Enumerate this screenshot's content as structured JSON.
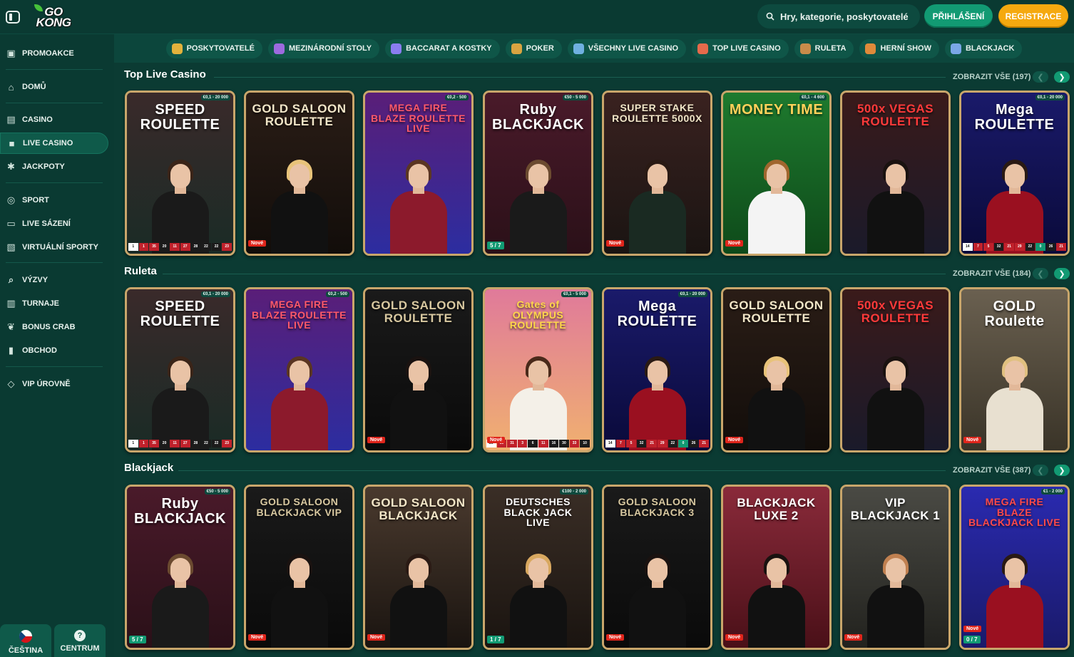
{
  "colors": {
    "bg": "#0b3b33",
    "accent_green": "#129a73",
    "accent_orange": "#f5a90f",
    "card_border": "#c9a66b",
    "badge_red": "#e0251b"
  },
  "header": {
    "logo_line1": "GO",
    "logo_line2": "KONG",
    "search_placeholder": "Hry, kategorie, poskytovatelé",
    "login_label": "Přihlášení",
    "register_label": "Registrace"
  },
  "sidebar": {
    "items": [
      {
        "label": "Promoakce",
        "icon": "gift-icon"
      },
      {
        "label": "Domů",
        "icon": "home-icon"
      },
      {
        "label": "Casino",
        "icon": "slot-machine-icon"
      },
      {
        "label": "Live Casino",
        "icon": "live-casino-icon",
        "active": true
      },
      {
        "label": "Jackpoty",
        "icon": "jackpot-icon"
      },
      {
        "label": "Sport",
        "icon": "soccer-ball-icon"
      },
      {
        "label": "Live sázení",
        "icon": "live-betting-icon"
      },
      {
        "label": "Virtuální sporty",
        "icon": "virtual-sports-icon"
      },
      {
        "label": "Výzvy",
        "icon": "challenge-icon"
      },
      {
        "label": "Turnaje",
        "icon": "tournament-icon"
      },
      {
        "label": "Bonus Crab",
        "icon": "crab-claw-icon"
      },
      {
        "label": "Obchod",
        "icon": "shop-bag-icon"
      },
      {
        "label": "VIP úrovně",
        "icon": "diamond-icon"
      }
    ],
    "language_label": "Čeština",
    "help_label": "Centrum"
  },
  "categories": [
    {
      "label": "Poskytovatelé",
      "color": "#e3b23c"
    },
    {
      "label": "Mezinárodní stoly",
      "color": "#9c6ade"
    },
    {
      "label": "Baccarat a kostky",
      "color": "#8a7df0"
    },
    {
      "label": "Poker",
      "color": "#d9a441"
    },
    {
      "label": "Všechny Live Casino",
      "color": "#6fb0e0"
    },
    {
      "label": "Top Live Casino",
      "color": "#e46a4b"
    },
    {
      "label": "Ruleta",
      "color": "#c88b4a"
    },
    {
      "label": "Herní show",
      "color": "#e08a3a"
    },
    {
      "label": "Blackjack",
      "color": "#7aa7e6"
    }
  ],
  "sections": [
    {
      "title": "Top Live Casino",
      "view_all": "Zobrazit vše (197)",
      "cards": [
        {
          "title": "SPEED ROULETTE",
          "limit": "€0,1 - 20 000",
          "bg": [
            "#3a2a2a",
            "#1a2b26"
          ],
          "title_color": "#ffffff",
          "hair": "#3a2418",
          "outfit": "#1a1a1a",
          "results": [
            "1",
            "1",
            "35",
            "20",
            "11",
            "27",
            "28",
            "22",
            "22",
            "23"
          ]
        },
        {
          "title": "GOLD SALOON ROULETTE",
          "tag": "Nové",
          "bg": [
            "#2a1d16",
            "#120d0a"
          ],
          "title_color": "#f2e6c8",
          "hair": "#e8c37a",
          "outfit": "#111111"
        },
        {
          "title": "MEGA FIRE BLAZE ROULETTE LIVE",
          "limit": "€0,2 - 500",
          "bg": [
            "#5a1e78",
            "#2c2da0"
          ],
          "title_color": "#ff5a6a",
          "hair": "#5a3522",
          "outfit": "#8c1a2c"
        },
        {
          "title": "Ruby BLACKJACK",
          "limit": "€50 - 5 000",
          "seats": "5 / 7",
          "bg": [
            "#4a1a2a",
            "#2a1018"
          ],
          "title_color": "#ffffff",
          "hair": "#6b4a30",
          "outfit": "#1a1a1a"
        },
        {
          "title": "SUPER STAKE ROULETTE 5000X",
          "tag": "Nové",
          "bg": [
            "#3a2220",
            "#1a1412"
          ],
          "title_color": "#f2e6c8",
          "hair": "#2a1a14",
          "outfit": "#1a2a22"
        },
        {
          "title": "MONEY TIME",
          "limit": "€0,1 - 4 600",
          "tag": "Nové",
          "bg": [
            "#1e7a2e",
            "#0e4a1a"
          ],
          "title_color": "#ffd25a",
          "hair": "#a0662e",
          "outfit": "#f4f4f4"
        },
        {
          "title": "500x VEGAS ROULETTE",
          "bg": [
            "#3a1a1a",
            "#1a1a2a"
          ],
          "title_color": "#ff3a3a",
          "hair": "#1a1210",
          "outfit": "#111111"
        },
        {
          "title": "Mega ROULETTE",
          "limit": "€0,1 - 20 000",
          "bg": [
            "#1a1a6a",
            "#0a0a3a"
          ],
          "title_color": "#ffffff",
          "hair": "#2a1a14",
          "outfit": "#9a1020",
          "results": [
            "14",
            "7",
            "5",
            "32",
            "21",
            "29",
            "22",
            "0",
            "26",
            "21"
          ]
        }
      ]
    },
    {
      "title": "Ruleta",
      "view_all": "Zobrazit vše (184)",
      "cards": [
        {
          "title": "SPEED ROULETTE",
          "limit": "€0,1 - 20 000",
          "bg": [
            "#3a2a2a",
            "#1a2b26"
          ],
          "title_color": "#ffffff",
          "hair": "#3a2418",
          "outfit": "#1a1a1a",
          "results": [
            "1",
            "1",
            "35",
            "20",
            "11",
            "27",
            "28",
            "22",
            "22",
            "23"
          ]
        },
        {
          "title": "MEGA FIRE BLAZE ROULETTE LIVE",
          "limit": "€0,2 - 500",
          "bg": [
            "#5a1e78",
            "#2c2da0"
          ],
          "title_color": "#ff5a6a",
          "hair": "#5a3522",
          "outfit": "#8c1a2c"
        },
        {
          "title": "GOLD SALOON ROULETTE",
          "tag": "Nové",
          "bg": [
            "#1a1a1a",
            "#0a0a0a"
          ],
          "title_color": "#d8c8a0",
          "hair": "#1a1210",
          "outfit": "#111111"
        },
        {
          "title": "Gates of OLYMPUS ROULETTE",
          "limit": "€0,1 - 5 000",
          "tag": "Nové",
          "bg": [
            "#e07a9a",
            "#f0b070"
          ],
          "title_color": "#ffd84a",
          "hair": "#4a2a1a",
          "outfit": "#f4f0e8",
          "results": [
            "26",
            "35",
            "31",
            "3",
            "6",
            "11",
            "16",
            "30",
            "33",
            "10"
          ]
        },
        {
          "title": "Mega ROULETTE",
          "limit": "€0,1 - 20 000",
          "bg": [
            "#1a1a6a",
            "#0a0a3a"
          ],
          "title_color": "#ffffff",
          "hair": "#2a1a14",
          "outfit": "#9a1020",
          "results": [
            "14",
            "7",
            "5",
            "32",
            "21",
            "29",
            "22",
            "0",
            "26",
            "21"
          ]
        },
        {
          "title": "GOLD SALOON ROULETTE",
          "tag": "Nové",
          "bg": [
            "#2a1d16",
            "#120d0a"
          ],
          "title_color": "#f2e6c8",
          "hair": "#e8c37a",
          "outfit": "#111111"
        },
        {
          "title": "500x VEGAS ROULETTE",
          "bg": [
            "#3a1a1a",
            "#1a1a2a"
          ],
          "title_color": "#ff3a3a",
          "hair": "#1a1210",
          "outfit": "#111111"
        },
        {
          "title": "GOLD Roulette",
          "tag": "Nové",
          "bg": [
            "#6a6050",
            "#3a3428"
          ],
          "title_color": "#ffffff",
          "hair": "#e0c080",
          "outfit": "#e8e0d0"
        }
      ]
    },
    {
      "title": "Blackjack",
      "view_all": "Zobrazit vše (387)",
      "cards": [
        {
          "title": "Ruby BLACKJACK",
          "limit": "€50 - 5 000",
          "seats": "5 / 7",
          "bg": [
            "#4a1a2a",
            "#2a1018"
          ],
          "title_color": "#ffffff",
          "hair": "#6b4a30",
          "outfit": "#1a1a1a"
        },
        {
          "title": "GOLD SALOON BLACKJACK VIP",
          "tag": "Nové",
          "bg": [
            "#1a1a1a",
            "#0a0a0a"
          ],
          "title_color": "#d8c8a0",
          "hair": "#1a1210",
          "outfit": "#111111"
        },
        {
          "title": "GOLD SALOON BLACKJACK",
          "tag": "Nové",
          "bg": [
            "#4a3a2e",
            "#1a1410"
          ],
          "title_color": "#f2e6c8",
          "hair": "#2a1a14",
          "outfit": "#111111"
        },
        {
          "title": "DEUTSCHES BLACK JACK LIVE",
          "limit": "€100 - 2 000",
          "seats": "1 / 7",
          "bg": [
            "#3a2e26",
            "#1a1410"
          ],
          "title_color": "#ffffff",
          "hair": "#d8a860",
          "outfit": "#111111"
        },
        {
          "title": "GOLD SALOON BLACKJACK 3",
          "tag": "Nové",
          "bg": [
            "#1a1a1a",
            "#0a0a0a"
          ],
          "title_color": "#d8c8a0",
          "hair": "#1a1210",
          "outfit": "#111111"
        },
        {
          "title": "BLACKJACK LUXE 2",
          "tag": "Nové",
          "bg": [
            "#8a2a3a",
            "#4a1018"
          ],
          "title_color": "#ffffff",
          "hair": "#1a1210",
          "outfit": "#111111"
        },
        {
          "title": "VIP BLACKJACK 1",
          "tag": "Nové",
          "bg": [
            "#4a4a44",
            "#22221e"
          ],
          "title_color": "#ffffff",
          "hair": "#c08050",
          "outfit": "#111111"
        },
        {
          "title": "MEGA FIRE BLAZE BLACKJACK LIVE",
          "limit": "€1 - 2 000",
          "tag": "Nové",
          "seats": "0 / 7",
          "bg": [
            "#2a2ab0",
            "#1a1a6a"
          ],
          "title_color": "#ff4a4a",
          "hair": "#2a1a14",
          "outfit": "#9a1020"
        }
      ]
    }
  ]
}
